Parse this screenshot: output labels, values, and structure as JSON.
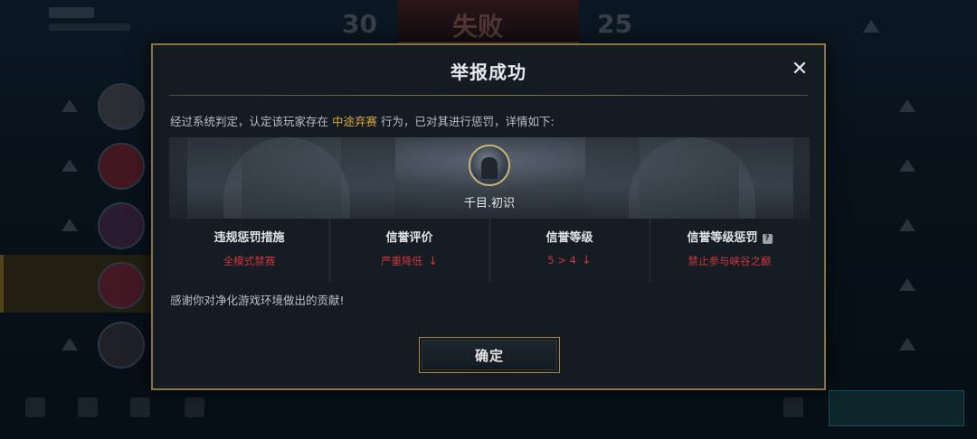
{
  "dialog": {
    "title": "举报成功",
    "close_icon": "close-icon",
    "description_prefix": "经过系统判定，认定该玩家存在",
    "description_highlight": "中途弃赛",
    "description_suffix": "行为，已对其进行惩罚，详情如下:",
    "player_name": "千目.初识",
    "columns": [
      {
        "header": "违规惩罚措施",
        "value": "全模式禁赛",
        "arrow": ""
      },
      {
        "header": "信誉评价",
        "value": "严重降低",
        "arrow": "↓"
      },
      {
        "header": "信誉等级",
        "value": "5 > 4",
        "arrow": "↓"
      },
      {
        "header": "信誉等级惩罚",
        "value": "禁止参与峡谷之巅",
        "arrow": "",
        "help_icon": "?"
      }
    ],
    "thanks": "感谢你对净化游戏环境做出的贡献!",
    "confirm_label": "确定"
  },
  "background": {
    "score_left": "30",
    "score_right": "25",
    "banner": "失败"
  },
  "colors": {
    "accent_gold": "#d9a640",
    "penalty_red": "#c9383a",
    "border_gold": "#8a7447"
  }
}
